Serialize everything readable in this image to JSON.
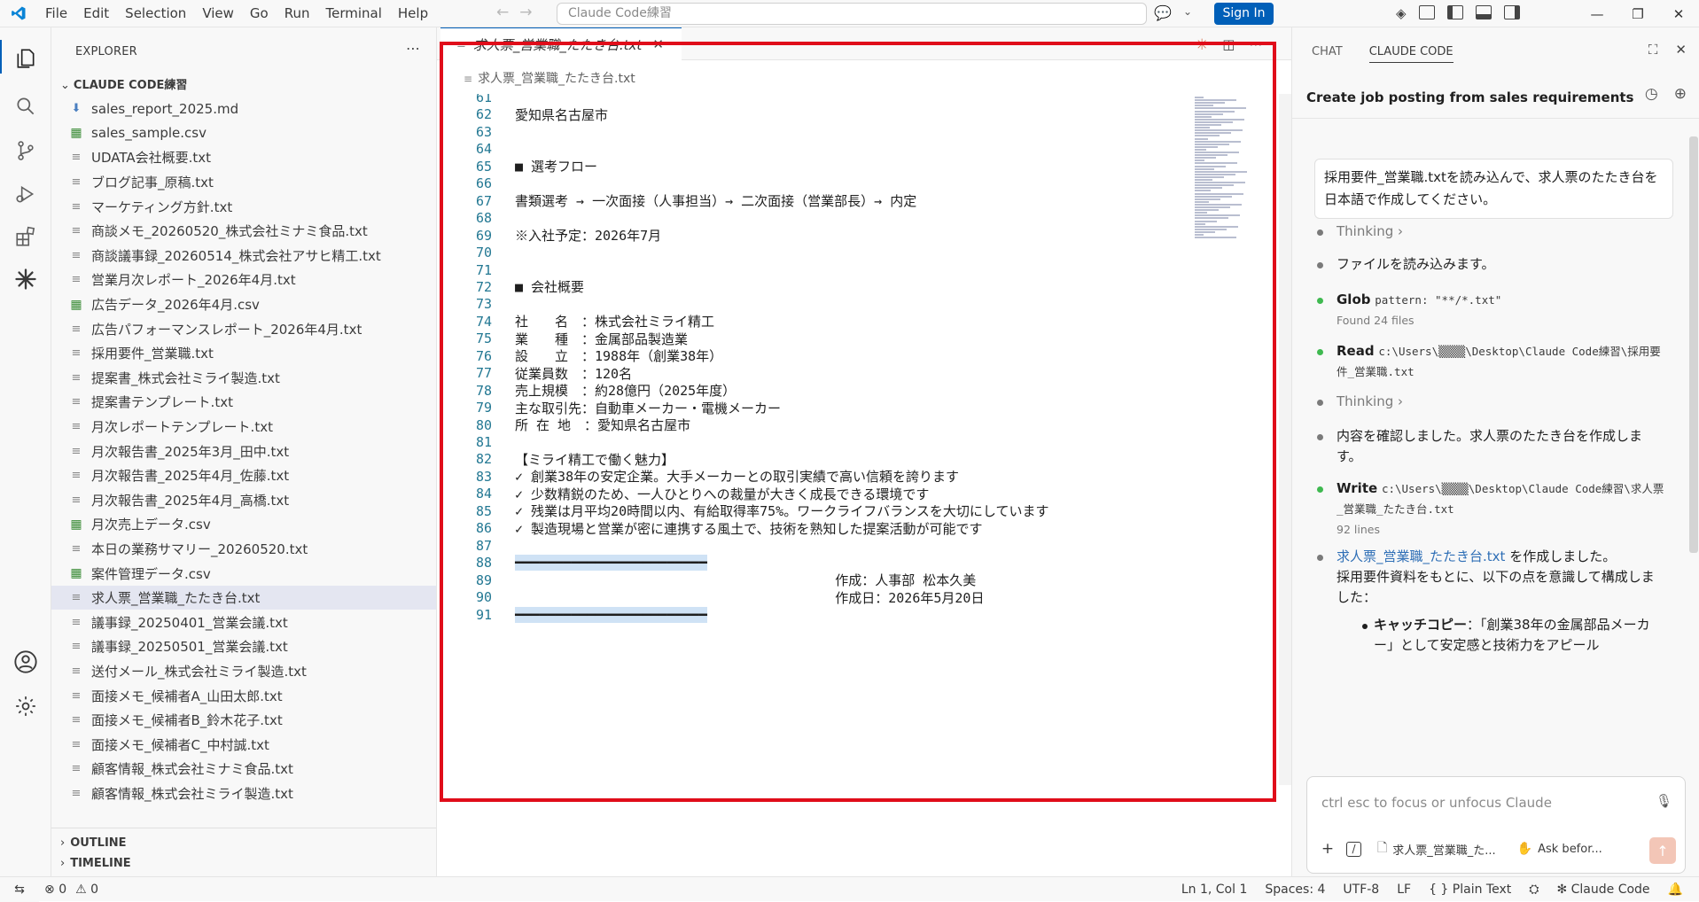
{
  "menu": [
    "File",
    "Edit",
    "Selection",
    "View",
    "Go",
    "Run",
    "Terminal",
    "Help"
  ],
  "command_center": "Claude Code練習",
  "signin_label": "Sign In",
  "explorer": {
    "title": "EXPLORER",
    "folder": "CLAUDE CODE練習",
    "files": [
      {
        "name": "sales_report_2025.md",
        "type": "md"
      },
      {
        "name": "sales_sample.csv",
        "type": "csv"
      },
      {
        "name": "UDATA会社概要.txt",
        "type": "txt"
      },
      {
        "name": "ブログ記事_原稿.txt",
        "type": "txt"
      },
      {
        "name": "マーケティング方針.txt",
        "type": "txt"
      },
      {
        "name": "商談メモ_20260520_株式会社ミナミ食品.txt",
        "type": "txt"
      },
      {
        "name": "商談議事録_20260514_株式会社アサヒ精工.txt",
        "type": "txt"
      },
      {
        "name": "営業月次レポート_2026年4月.txt",
        "type": "txt"
      },
      {
        "name": "広告データ_2026年4月.csv",
        "type": "csv"
      },
      {
        "name": "広告パフォーマンスレポート_2026年4月.txt",
        "type": "txt"
      },
      {
        "name": "採用要件_営業職.txt",
        "type": "txt"
      },
      {
        "name": "提案書_株式会社ミライ製造.txt",
        "type": "txt"
      },
      {
        "name": "提案書テンプレート.txt",
        "type": "txt"
      },
      {
        "name": "月次レポートテンプレート.txt",
        "type": "txt"
      },
      {
        "name": "月次報告書_2025年3月_田中.txt",
        "type": "txt"
      },
      {
        "name": "月次報告書_2025年4月_佐藤.txt",
        "type": "txt"
      },
      {
        "name": "月次報告書_2025年4月_高橋.txt",
        "type": "txt"
      },
      {
        "name": "月次売上データ.csv",
        "type": "csv"
      },
      {
        "name": "本日の業務サマリー_20260520.txt",
        "type": "txt"
      },
      {
        "name": "案件管理データ.csv",
        "type": "csv"
      },
      {
        "name": "求人票_営業職_たたき台.txt",
        "type": "txt",
        "selected": true
      },
      {
        "name": "議事録_20250401_営業会議.txt",
        "type": "txt"
      },
      {
        "name": "議事録_20250501_営業会議.txt",
        "type": "txt"
      },
      {
        "name": "送付メール_株式会社ミライ製造.txt",
        "type": "txt"
      },
      {
        "name": "面接メモ_候補者A_山田太郎.txt",
        "type": "txt"
      },
      {
        "name": "面接メモ_候補者B_鈴木花子.txt",
        "type": "txt"
      },
      {
        "name": "面接メモ_候補者C_中村誠.txt",
        "type": "txt"
      },
      {
        "name": "顧客情報_株式会社ミナミ食品.txt",
        "type": "txt"
      },
      {
        "name": "顧客情報_株式会社ミライ製造.txt",
        "type": "txt"
      }
    ],
    "outline": "OUTLINE",
    "timeline": "TIMELINE"
  },
  "editor": {
    "tab_title": "求人票_営業職_たたき台.txt",
    "breadcrumb": "求人票_営業職_たたき台.txt",
    "lines": [
      {
        "n": "61",
        "t": ""
      },
      {
        "n": "62",
        "t": "愛知県名古屋市"
      },
      {
        "n": "63",
        "t": ""
      },
      {
        "n": "64",
        "t": ""
      },
      {
        "n": "65",
        "t": "■ 選考フロー"
      },
      {
        "n": "66",
        "t": ""
      },
      {
        "n": "67",
        "t": "書類選考 → 一次面接（人事担当）→ 二次面接（営業部長）→ 内定"
      },
      {
        "n": "68",
        "t": ""
      },
      {
        "n": "69",
        "t": "※入社予定：2026年7月"
      },
      {
        "n": "70",
        "t": ""
      },
      {
        "n": "71",
        "t": ""
      },
      {
        "n": "72",
        "t": "■ 会社概要"
      },
      {
        "n": "73",
        "t": ""
      },
      {
        "n": "74",
        "t": "社　　名　：株式会社ミライ精工"
      },
      {
        "n": "75",
        "t": "業　　種　：金属部品製造業"
      },
      {
        "n": "76",
        "t": "設　　立　：1988年（創業38年）"
      },
      {
        "n": "77",
        "t": "従業員数　：120名"
      },
      {
        "n": "78",
        "t": "売上規模　：約28億円（2025年度）"
      },
      {
        "n": "79",
        "t": "主な取引先：自動車メーカー・電機メーカー"
      },
      {
        "n": "80",
        "t": "所 在 地　：愛知県名古屋市"
      },
      {
        "n": "81",
        "t": ""
      },
      {
        "n": "82",
        "t": "【ミライ精工で働く魅力】"
      },
      {
        "n": "83",
        "t": "✓ 創業38年の安定企業。大手メーカーとの取引実績で高い信頼を誇ります"
      },
      {
        "n": "84",
        "t": "✓ 少数精鋭のため、一人ひとりへの裁量が大きく成長できる環境です"
      },
      {
        "n": "85",
        "t": "✓ 残業は月平均20時間以内、有給取得率75%。ワークライフバランスを大切にしています"
      },
      {
        "n": "86",
        "t": "✓ 製造現場と営業が密に連携する風土で、技術を熟知した提案活動が可能です"
      },
      {
        "n": "87",
        "t": ""
      },
      {
        "n": "88",
        "t": "━━━━━━━━━━━━━━━━━━━━━━━━",
        "hl": true
      },
      {
        "n": "89",
        "t": "                                        作成：人事部 松本久美"
      },
      {
        "n": "90",
        "t": "                                        作成日：2026年5月20日"
      },
      {
        "n": "91",
        "t": "━━━━━━━━━━━━━━━━━━━━━━━━",
        "hl": true
      }
    ]
  },
  "panel": {
    "tab_chat": "CHAT",
    "tab_claude": "CLAUDE CODE",
    "conversation_title": "Create job posting from sales requirements",
    "user_message": "採用要件_営業職.txtを読み込んで、求人票のたたき台を日本語で作成してください。",
    "thinking_label": "Thinking",
    "step_read_files": "ファイルを読み込みます。",
    "glob_label": "Glob",
    "glob_arg": "pattern: \"**/*.txt\"",
    "glob_result": "Found 24 files",
    "read_label": "Read",
    "read_arg": "c:\\Users\\▒▒▒▒\\Desktop\\Claude Code練習\\採用要件_営業職.txt",
    "step_confirm": "内容を確認しました。求人票のたたき台を作成します。",
    "write_label": "Write",
    "write_arg": "c:\\Users\\▒▒▒▒\\Desktop\\Claude Code練習\\求人票_営業職_たたき台.txt",
    "write_result": "92 lines",
    "created_link": "求人票_営業職_たたき台.txt",
    "created_suffix": " を作成しました。",
    "created_detail": "採用要件資料をもとに、以下の点を意識して構成しました：",
    "bullet_title": "キャッチコピー",
    "bullet_text": "：「創業38年の金属部品メーカー」として安定感と技術力をアピール",
    "prompt_placeholder": "ctrl esc to focus or unfocus Claude",
    "attached_file": "求人票_営業職_た...",
    "mode_label": "Ask befor..."
  },
  "status": {
    "errors": "0",
    "warnings": "0",
    "position": "Ln 1, Col 1",
    "spaces": "Spaces: 4",
    "encoding": "UTF-8",
    "eol": "LF",
    "language": "Plain Text",
    "claude": "Claude Code"
  },
  "colors": {
    "accent": "#005fb8",
    "highlight_frame": "#e00d1a",
    "claude_orange": "#d97757",
    "success_dot": "#3fb950"
  }
}
